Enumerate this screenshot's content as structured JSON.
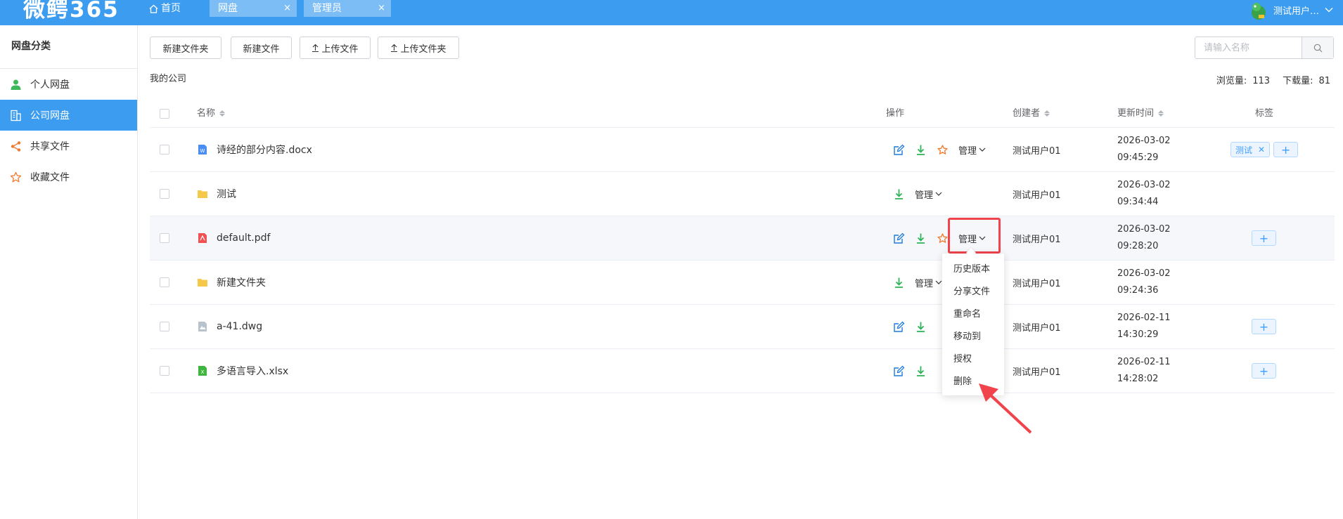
{
  "app": {
    "brand": "微鳄365",
    "user_name": "测试用户…"
  },
  "nav": {
    "home_label": "首页",
    "tabs": [
      {
        "label": "网盘",
        "close": "×"
      },
      {
        "label": "管理员",
        "close": "×"
      }
    ]
  },
  "sidebar": {
    "title": "网盘分类",
    "items": [
      {
        "label": "个人网盘",
        "icon": "user-icon",
        "color": "#3db85c"
      },
      {
        "label": "公司网盘",
        "icon": "building-icon",
        "active": true
      },
      {
        "label": "共享文件",
        "icon": "share-icon",
        "color": "#f07b2e"
      },
      {
        "label": "收藏文件",
        "icon": "star-icon",
        "color": "#f07b2e"
      }
    ]
  },
  "toolbar": {
    "new_folder": "新建文件夹",
    "new_file": "新建文件",
    "upload_file": "上传文件",
    "upload_folder": "上传文件夹",
    "search_placeholder": "请输入名称"
  },
  "breadcrumb": "我的公司",
  "stats": {
    "views_label": "浏览量:",
    "views": "113",
    "downloads_label": "下载量:",
    "downloads": "81"
  },
  "table": {
    "headers": {
      "name": "名称",
      "ops": "操作",
      "creator": "创建者",
      "updated": "更新时间",
      "tags": "标签"
    },
    "manage_label": "管理",
    "rows": [
      {
        "name": "诗经的部分内容.docx",
        "type": "docx",
        "creator": "测试用户01",
        "date": "2026-03-02",
        "time": "09:45:29",
        "tag": "测试"
      },
      {
        "name": "测试",
        "type": "folder",
        "creator": "测试用户01",
        "date": "2026-03-02",
        "time": "09:34:44"
      },
      {
        "name": "default.pdf",
        "type": "pdf",
        "creator": "测试用户01",
        "date": "2026-03-02",
        "time": "09:28:20"
      },
      {
        "name": "新建文件夹",
        "type": "folder",
        "creator": "测试用户01",
        "date": "2026-03-02",
        "time": "09:24:36"
      },
      {
        "name": "a-41.dwg",
        "type": "dwg",
        "creator": "测试用户01",
        "date": "2026-02-11",
        "time": "14:30:29"
      },
      {
        "name": "多语言导入.xlsx",
        "type": "xlsx",
        "creator": "测试用户01",
        "date": "2026-02-11",
        "time": "14:28:02"
      }
    ]
  },
  "dropdown": {
    "items": [
      "历史版本",
      "分享文件",
      "重命名",
      "移动到",
      "授权",
      "删除"
    ]
  },
  "colors": {
    "brand_blue": "#3c9cf0",
    "highlight_red": "#f0434b",
    "green": "#2fb45a",
    "edit_blue": "#1f7bd8",
    "star_orange": "#f07b2e"
  }
}
